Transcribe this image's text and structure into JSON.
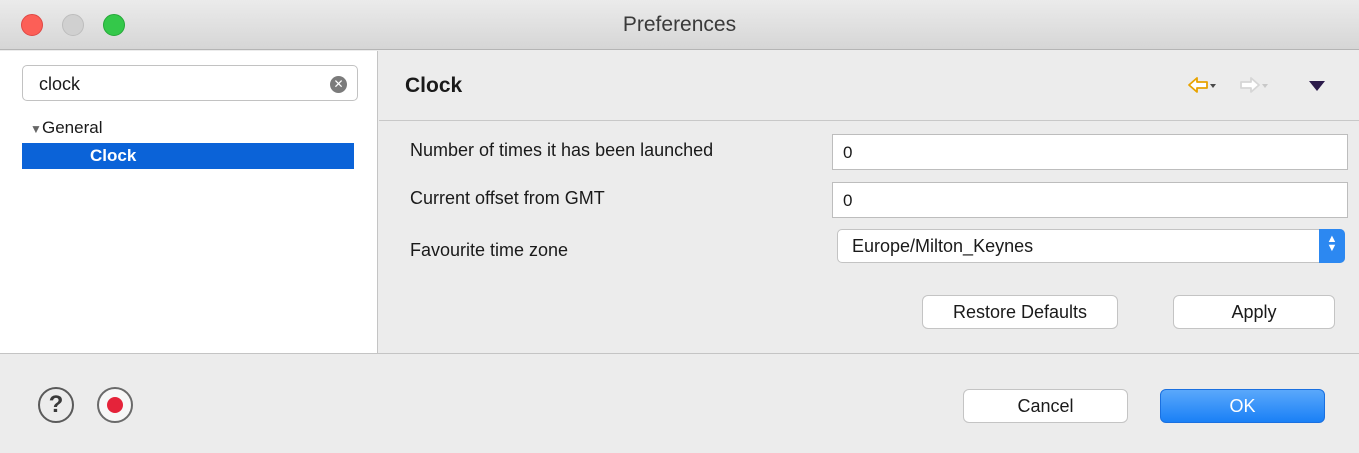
{
  "window": {
    "title": "Preferences"
  },
  "sidebar": {
    "filter": {
      "value": "clock"
    },
    "tree": [
      {
        "label": "General",
        "expanded": true
      },
      {
        "label": "Clock",
        "selected": true
      }
    ]
  },
  "page": {
    "title": "Clock",
    "fields": [
      {
        "label": "Number of times it has been launched",
        "value": "0"
      },
      {
        "label": "Current offset from GMT",
        "value": "0"
      },
      {
        "label": "Favourite time zone",
        "value": "Europe/Milton_Keynes"
      }
    ],
    "restore_label": "Restore Defaults",
    "apply_label": "Apply"
  },
  "footer": {
    "cancel_label": "Cancel",
    "ok_label": "OK"
  },
  "colors": {
    "selection": "#0b63d8",
    "accent": "#1a80f6",
    "back_arrow": "#e8a300"
  }
}
